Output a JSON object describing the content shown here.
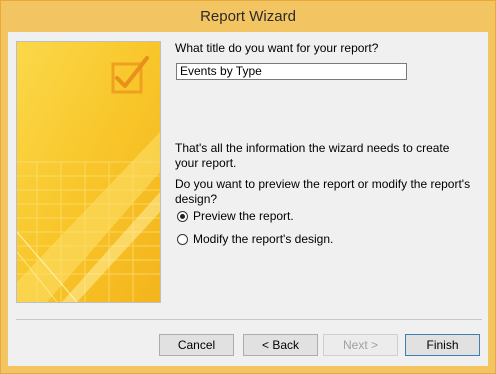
{
  "window": {
    "title": "Report Wizard"
  },
  "form": {
    "title_question": "What title do you want for your report?",
    "title_value": "Events by Type",
    "info_text": "That's all the information the wizard needs to create your report.",
    "preview_question": "Do you want to preview the report or modify the report's design?",
    "options": [
      {
        "label": "Preview the report.",
        "selected": true
      },
      {
        "label": "Modify the report's design.",
        "selected": false
      }
    ]
  },
  "buttons": {
    "cancel": "Cancel",
    "back": "< Back",
    "next": "Next >",
    "finish": "Finish"
  },
  "colors": {
    "titlebar": "#f3c562",
    "art_background": "#f9cd2e",
    "default_button_border": "#3c7fb1"
  },
  "icons": {
    "art": "wizard-checkbox-illustration"
  }
}
